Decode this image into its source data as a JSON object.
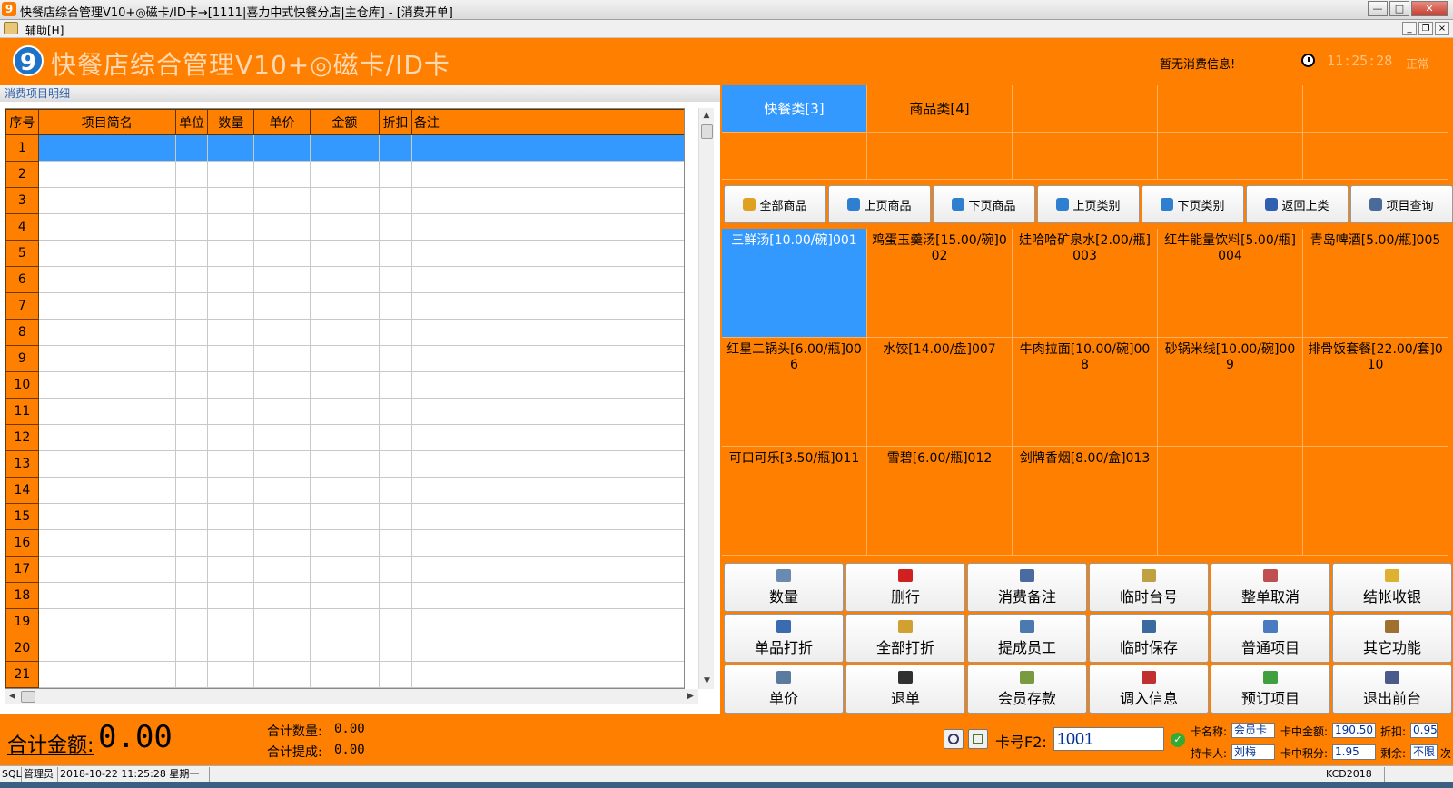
{
  "window": {
    "title": "快餐店综合管理V10+◎磁卡/ID卡→[1111|喜力中式快餐分店|主仓库] - [消费开单]",
    "min": "—",
    "max": "□",
    "close": "✕",
    "app_icon": "9"
  },
  "menu": {
    "help": "辅助[H]",
    "mdi_min": "_",
    "mdi_max": "❐",
    "mdi_close": "×"
  },
  "header": {
    "logo": "9",
    "title": "快餐店综合管理V10+◎磁卡/ID卡",
    "no_consume": "暂无消费信息!",
    "time": "11:25:28",
    "status": "正常"
  },
  "left": {
    "caption": "消费项目明细",
    "columns": [
      "序号",
      "项目简名",
      "单位",
      "数量",
      "单价",
      "金额",
      "折扣",
      "备注"
    ],
    "rows": [
      "1",
      "2",
      "3",
      "4",
      "5",
      "6",
      "7",
      "8",
      "9",
      "10",
      "11",
      "12",
      "13",
      "14",
      "15",
      "16",
      "17",
      "18",
      "19",
      "20",
      "21"
    ],
    "scroll_up": "▲",
    "scroll_down": "▼",
    "scroll_left": "◀",
    "scroll_right": "▶"
  },
  "categories": {
    "items": [
      "快餐类[3]",
      "商品类[4]"
    ]
  },
  "nav": [
    {
      "label": "全部商品",
      "icon": "all-goods-icon",
      "color": "#e0a020"
    },
    {
      "label": "上页商品",
      "icon": "arrow-left-icon",
      "color": "#2f7fd0"
    },
    {
      "label": "下页商品",
      "icon": "arrow-right-icon",
      "color": "#2f7fd0"
    },
    {
      "label": "上页类别",
      "icon": "arrow-left-icon",
      "color": "#2f7fd0"
    },
    {
      "label": "下页类别",
      "icon": "arrow-right-icon",
      "color": "#2f7fd0"
    },
    {
      "label": "返回上类",
      "icon": "return-icon",
      "color": "#2f5fb0"
    },
    {
      "label": "项目查询",
      "icon": "search-icon",
      "color": "#4a6a9a"
    }
  ],
  "products": [
    "三鲜汤[10.00/碗]001",
    "鸡蛋玉羹汤[15.00/碗]002",
    "娃哈哈矿泉水[2.00/瓶]003",
    "红牛能量饮料[5.00/瓶]004",
    "青岛啤酒[5.00/瓶]005",
    "红星二锅头[6.00/瓶]006",
    "水饺[14.00/盘]007",
    "牛肉拉面[10.00/碗]008",
    "砂锅米线[10.00/碗]009",
    "排骨饭套餐[22.00/套]010",
    "可口可乐[3.50/瓶]011",
    "雪碧[6.00/瓶]012",
    "剑牌香烟[8.00/盒]013"
  ],
  "functions": [
    {
      "label": "数量",
      "icon": "quantity-icon",
      "color": "#6a8ab0"
    },
    {
      "label": "删行",
      "icon": "delete-icon",
      "color": "#d02020"
    },
    {
      "label": "消费备注",
      "icon": "note-icon",
      "color": "#4a6aa0"
    },
    {
      "label": "临时台号",
      "icon": "home-icon",
      "color": "#c0a040"
    },
    {
      "label": "整单取消",
      "icon": "cancel-icon",
      "color": "#c05050"
    },
    {
      "label": "结帐收银",
      "icon": "checkout-icon",
      "color": "#e0b030"
    },
    {
      "label": "单品打折",
      "icon": "check-icon",
      "color": "#3a6ab0"
    },
    {
      "label": "全部打折",
      "icon": "discount-icon",
      "color": "#d0a030"
    },
    {
      "label": "提成员工",
      "icon": "staff-icon",
      "color": "#4a7ab0"
    },
    {
      "label": "临时保存",
      "icon": "save-icon",
      "color": "#3a6aa0"
    },
    {
      "label": "普通项目",
      "icon": "list-icon",
      "color": "#4a7ac0"
    },
    {
      "label": "其它功能",
      "icon": "gear-icon",
      "color": "#a07030"
    },
    {
      "label": "单价",
      "icon": "price-icon",
      "color": "#5a7aa0"
    },
    {
      "label": "退单",
      "icon": "minus-icon",
      "color": "#303030"
    },
    {
      "label": "会员存款",
      "icon": "deposit-icon",
      "color": "#7a9a40"
    },
    {
      "label": "调入信息",
      "icon": "import-icon",
      "color": "#c03030"
    },
    {
      "label": "预订项目",
      "icon": "booking-icon",
      "color": "#40a040"
    },
    {
      "label": "退出前台",
      "icon": "exit-icon",
      "color": "#4a5a8a"
    }
  ],
  "summary": {
    "total_label": "合计金额:",
    "total_value": "0.00",
    "qty_label": "合计数量:",
    "qty_value": "0.00",
    "commission_label": "合计提成:",
    "commission_value": "0.00"
  },
  "card": {
    "label": "卡号F2:",
    "value": "1001",
    "name_label": "卡名称:",
    "name_value": "会员卡",
    "balance_label": "卡中金额:",
    "balance_value": "190.50",
    "discount_label": "折扣:",
    "discount_value": "0.95",
    "holder_label": "持卡人:",
    "holder_value": "刘梅",
    "points_label": "卡中积分:",
    "points_value": "1.95",
    "remain_label": "剩余:",
    "remain_value": "不限",
    "times_unit": "次"
  },
  "statusbar": {
    "db": "SQL",
    "user": "管理员",
    "datetime": "2018-10-22 11:25:28 星期一",
    "version": "KCD2018"
  }
}
